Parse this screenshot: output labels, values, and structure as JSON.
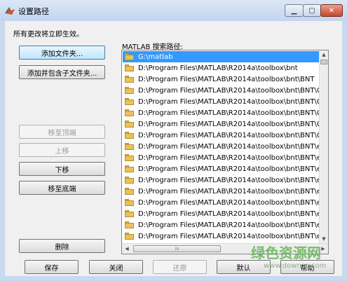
{
  "window": {
    "title": "设置路径",
    "min_symbol": "▁",
    "max_symbol": "▢",
    "close_symbol": "✕"
  },
  "message": "所有更改将立即生效。",
  "left_buttons": {
    "add_folder": "添加文件夹...",
    "add_with_subfolders": "添加并包含子文件夹...",
    "move_to_top": "移至顶端",
    "move_up": "上移",
    "move_down": "下移",
    "move_to_bottom": "移至底端",
    "remove": "删除"
  },
  "path_list": {
    "label": "MATLAB 搜索路径:",
    "items": [
      "G:\\matlab",
      "D:\\Program Files\\MATLAB\\R2014a\\toolbox\\bnt",
      "D:\\Program Files\\MATLAB\\R2014a\\toolbox\\bnt\\BNT",
      "D:\\Program Files\\MATLAB\\R2014a\\toolbox\\bnt\\BNT\\C",
      "D:\\Program Files\\MATLAB\\R2014a\\toolbox\\bnt\\BNT\\C",
      "D:\\Program Files\\MATLAB\\R2014a\\toolbox\\bnt\\BNT\\C",
      "D:\\Program Files\\MATLAB\\R2014a\\toolbox\\bnt\\BNT\\C",
      "D:\\Program Files\\MATLAB\\R2014a\\toolbox\\bnt\\BNT\\C",
      "D:\\Program Files\\MATLAB\\R2014a\\toolbox\\bnt\\BNT\\e",
      "D:\\Program Files\\MATLAB\\R2014a\\toolbox\\bnt\\BNT\\e",
      "D:\\Program Files\\MATLAB\\R2014a\\toolbox\\bnt\\BNT\\e",
      "D:\\Program Files\\MATLAB\\R2014a\\toolbox\\bnt\\BNT\\e",
      "D:\\Program Files\\MATLAB\\R2014a\\toolbox\\bnt\\BNT\\e",
      "D:\\Program Files\\MATLAB\\R2014a\\toolbox\\bnt\\BNT\\e",
      "D:\\Program Files\\MATLAB\\R2014a\\toolbox\\bnt\\BNT\\e",
      "D:\\Program Files\\MATLAB\\R2014a\\toolbox\\bnt\\BNT\\e",
      "D:\\Program Files\\MATLAB\\R2014a\\toolbox\\bnt\\BNT\\e"
    ],
    "selected_index": 0
  },
  "scroll": {
    "up": "▲",
    "down": "▼",
    "left": "◀",
    "right": "▶",
    "grip": "III"
  },
  "bottom_buttons": {
    "save": "保存",
    "close": "关闭",
    "revert": "还原",
    "default": "默认",
    "help": "帮助"
  },
  "watermark": {
    "text": "绿色资源网",
    "url": "www.downcc.com"
  },
  "colors": {
    "selection": "#3399ff",
    "folder": "#e8c35a",
    "watermark": "#5bb04a"
  }
}
